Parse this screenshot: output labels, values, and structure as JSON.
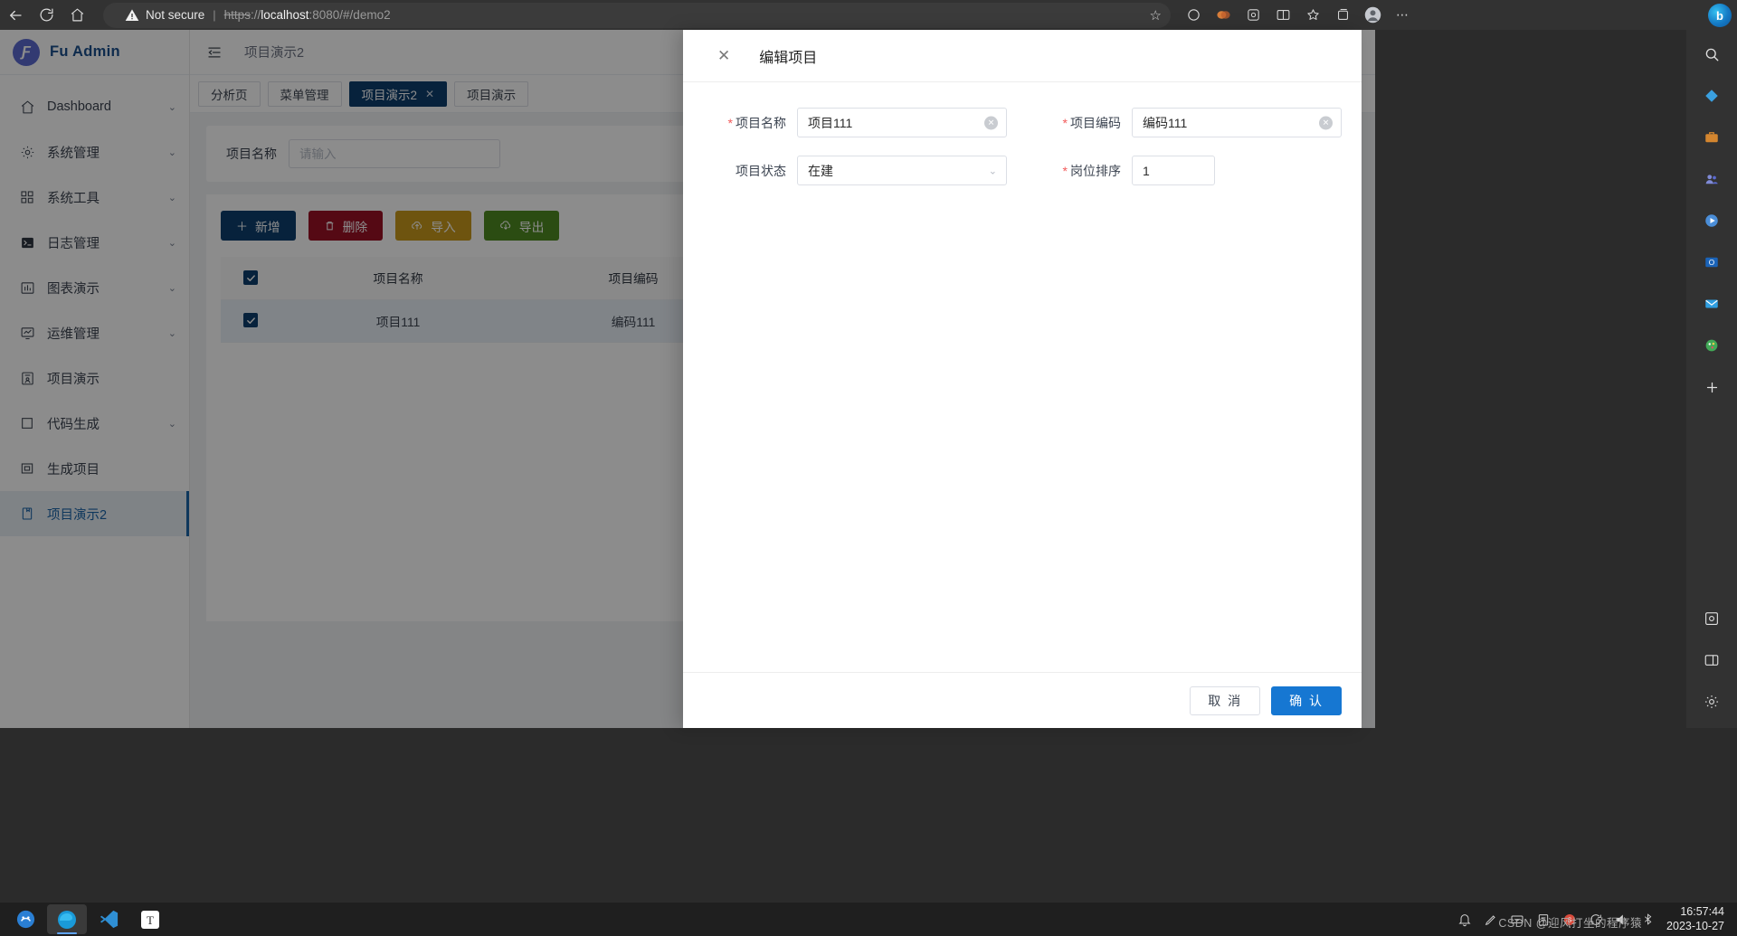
{
  "browser": {
    "back_icon": "back-arrow-icon",
    "reload_icon": "reload-icon",
    "home_icon": "home-icon",
    "security_label": "Not secure",
    "url_scheme": "https",
    "url_sep": "://",
    "url_host": "localhost",
    "url_rest": ":8080/#/demo2",
    "star_icon": "favorite-star-icon"
  },
  "sidebar": {
    "brand": "Fu Admin",
    "items": [
      {
        "label": "Dashboard",
        "icon": "home-icon",
        "caret": true,
        "active": false
      },
      {
        "label": "系统管理",
        "icon": "gear-icon",
        "caret": true,
        "active": false
      },
      {
        "label": "系统工具",
        "icon": "grid-icon",
        "caret": true,
        "active": false
      },
      {
        "label": "日志管理",
        "icon": "terminal-icon",
        "caret": true,
        "active": false
      },
      {
        "label": "图表演示",
        "icon": "chart-icon",
        "caret": true,
        "active": false
      },
      {
        "label": "运维管理",
        "icon": "monitor-icon",
        "caret": true,
        "active": false
      },
      {
        "label": "项目演示",
        "icon": "project-icon",
        "caret": false,
        "active": false
      },
      {
        "label": "代码生成",
        "icon": "square-icon",
        "caret": true,
        "active": false
      },
      {
        "label": "生成项目",
        "icon": "window-icon",
        "caret": false,
        "active": false
      },
      {
        "label": "项目演示2",
        "icon": "document-icon",
        "caret": false,
        "active": true
      }
    ]
  },
  "topbar": {
    "collapse_icon": "collapse-sidebar-icon",
    "breadcrumb": "项目演示2"
  },
  "tabs": [
    {
      "label": "分析页",
      "active": false,
      "closable": false
    },
    {
      "label": "菜单管理",
      "active": false,
      "closable": false
    },
    {
      "label": "项目演示2",
      "active": true,
      "closable": true
    },
    {
      "label": "项目演示",
      "active": false,
      "closable": false
    }
  ],
  "filter": {
    "label": "项目名称",
    "placeholder": "请输入",
    "value": ""
  },
  "toolbar": [
    {
      "label": "新增",
      "icon": "plus-icon",
      "color": "#0d3f6e"
    },
    {
      "label": "删除",
      "icon": "trash-icon",
      "color": "#9b1226"
    },
    {
      "label": "导入",
      "icon": "upload-icon",
      "color": "#c89a1d"
    },
    {
      "label": "导出",
      "icon": "download-icon",
      "color": "#4f8a22"
    }
  ],
  "table": {
    "select_all_checked": true,
    "columns": [
      "项目名称",
      "项目编码"
    ],
    "rows": [
      {
        "checked": true,
        "项目名称": "项目111",
        "项目编码": "编码111"
      }
    ]
  },
  "modal": {
    "title": "编辑项目",
    "close_icon": "close-icon",
    "fields": [
      {
        "label": "项目名称",
        "required": true,
        "type": "text",
        "value": "项目111",
        "clearable": true
      },
      {
        "label": "项目编码",
        "required": true,
        "type": "text",
        "value": "编码111",
        "clearable": true
      },
      {
        "label": "项目状态",
        "required": false,
        "type": "select",
        "value": "在建"
      },
      {
        "label": "岗位排序",
        "required": true,
        "type": "number",
        "value": "1"
      }
    ],
    "cancel_label": "取 消",
    "confirm_label": "确 认",
    "accent_color": "#1677d2"
  },
  "edge_sidebar": {
    "icons": [
      "search-icon",
      "diamond-icon",
      "briefcase-icon",
      "people-icon",
      "media-icon",
      "outlook-icon",
      "mail-icon",
      "paint-icon",
      "plus-icon",
      "screenshot-icon",
      "split-screen-icon",
      "settings-icon"
    ]
  },
  "taskbar": {
    "apps": [
      "start-icon",
      "edge-icon",
      "vscode-icon",
      "typora-icon"
    ],
    "tray": [
      "notify-icon",
      "pen-icon",
      "cast-icon",
      "clipboard-icon",
      "sogou-icon",
      "sync-icon",
      "volume-icon",
      "bluetooth-icon"
    ],
    "time": "16:57:44",
    "date": "2023-10-27",
    "watermark": "CSDN @迎风打坐的程序猿"
  }
}
